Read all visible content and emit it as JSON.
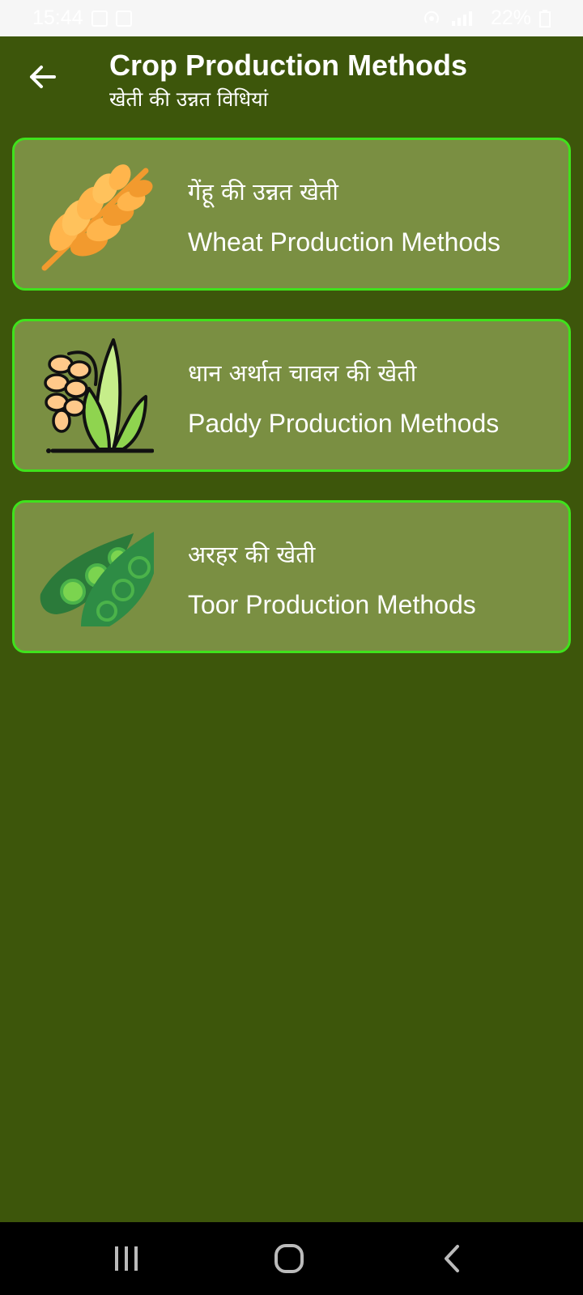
{
  "status_bar": {
    "time": "15:44",
    "battery": "22%"
  },
  "header": {
    "title": "Crop Production Methods",
    "subtitle": "खेती की उन्नत विधियां"
  },
  "cards": [
    {
      "hindi": "गेंहू की उन्नत खेती",
      "english": "Wheat Production Methods",
      "icon": "wheat-icon"
    },
    {
      "hindi": "धान अर्थात चावल की खेती",
      "english": "Paddy Production Methods",
      "icon": "paddy-icon"
    },
    {
      "hindi": "अरहर की खेती",
      "english": "Toor Production Methods",
      "icon": "pea-pod-icon"
    }
  ],
  "colors": {
    "background": "#3d560b",
    "card": "#7a8f42",
    "card_border": "#3fe21c"
  }
}
